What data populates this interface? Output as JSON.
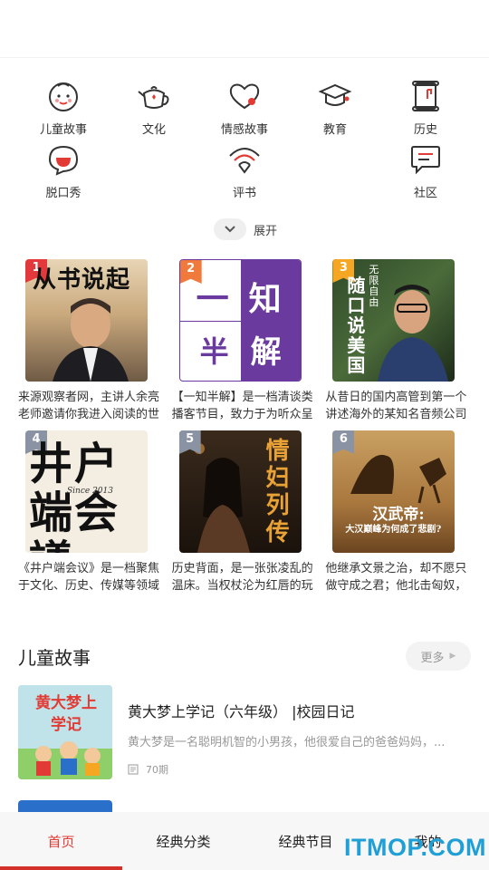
{
  "categories": {
    "row1": [
      {
        "label": "儿童故事",
        "icon": "child-face-icon"
      },
      {
        "label": "文化",
        "icon": "teapot-icon"
      },
      {
        "label": "情感故事",
        "icon": "heart-icon"
      },
      {
        "label": "教育",
        "icon": "graduation-cap-icon"
      },
      {
        "label": "历史",
        "icon": "scroll-icon"
      }
    ],
    "row2": [
      {
        "label": "脱口秀",
        "icon": "mic-bubble-icon"
      },
      {
        "label": "评书",
        "icon": "fan-icon"
      },
      {
        "label": "社区",
        "icon": "chat-icon"
      }
    ]
  },
  "expand": {
    "label": "展开"
  },
  "books": [
    {
      "rank": "1",
      "cover_text": "从书说起",
      "desc": "来源观察者网，主讲人余亮老师邀请你我进入阅读的世界，书中自有"
    },
    {
      "rank": "2",
      "cover_text_a": "一",
      "cover_text_b": "知",
      "cover_text_c": "半",
      "cover_text_d": "解",
      "desc": "【一知半解】是一档清谈类播客节目，致力于为听众呈现被忽略的冷"
    },
    {
      "rank": "3",
      "cover_text": "随口说美国",
      "cover_sub": "无限自由",
      "desc": "从昔日的国内高管到第一个讲述海外的某知名音频公司平台头部主"
    },
    {
      "rank": "4",
      "cover_text": "井户端会議",
      "cover_sub": "Since 2013",
      "desc": "《井户端会议》是一档聚焦于文化、历史、传媒等领域的对谈型播"
    },
    {
      "rank": "5",
      "cover_text": "情妇列传",
      "desc": "历史背面，是一张张凌乱的温床。当权杖沦为红唇的玩物，最冷酷的"
    },
    {
      "rank": "6",
      "cover_text": "汉武帝:",
      "cover_sub": "大汉巅峰为何成了悲剧?",
      "desc": "他继承文景之治，却不愿只做守成之君；他北击匈奴，打通西域，让"
    }
  ],
  "section": {
    "title": "儿童故事",
    "more_label": "更多"
  },
  "program": {
    "title": "黄大梦上学记（六年级） |校园日记",
    "desc": "黄大梦是一名聪明机智的小男孩，他很爱自己的爸爸妈妈，...",
    "episodes": "70期",
    "cover_text": "黄大梦上学记"
  },
  "tabs": [
    {
      "label": "首页",
      "active": true
    },
    {
      "label": "经典分类",
      "active": false
    },
    {
      "label": "经典节目",
      "active": false
    },
    {
      "label": "我的",
      "active": false
    }
  ],
  "watermark": "ITMOP.COM",
  "colors": {
    "accent": "#e23b35",
    "rank1": "#e4393c",
    "rank2": "#f07a3c",
    "rank3": "#f5a623",
    "rank_other": "#8a93a3"
  }
}
